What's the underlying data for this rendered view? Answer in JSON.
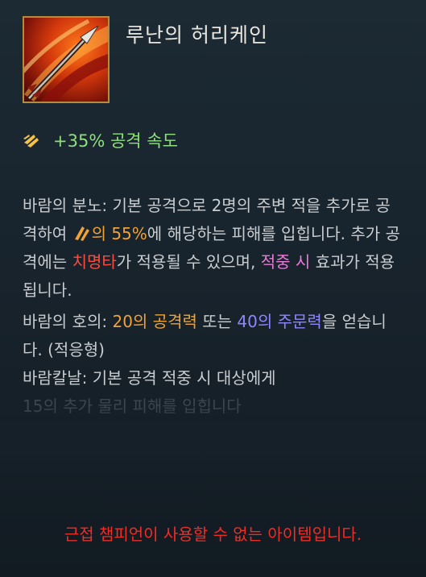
{
  "item": {
    "name": "루난의 허리케인",
    "icon": "hurricane-arrow-icon"
  },
  "stat": {
    "icon": "attack-speed-icon",
    "text": "+35% 공격 속도",
    "color": "#8fe07c"
  },
  "passive1": {
    "name": "바람의 분노:",
    "text1": " 기본 공격으로 2명의 주변 적을 추가로 공격하여 ",
    "ad_icon": "attack-damage-icon",
    "ratio": "의 55%",
    "text2": "에 해당하는 피해를 입힙니다. 추가 공격에는 ",
    "crit": "치명타",
    "text3": "가 적용될 수 있으며, ",
    "onhit": "적중 시",
    "text4": " 효과가 적용됩니다."
  },
  "passive2": {
    "name": "바람의 호의:",
    "text1": " ",
    "ad": "20의 공격력",
    "text2": " 또는 ",
    "ap": "40의 주문력",
    "text3": "을 얻습니다. (적응형)"
  },
  "passive3": {
    "name": "바람칼날:",
    "text1": " 기본 공격 적중 시 대상에게",
    "faded_text": "15의 추가 물리 피해를 입힙니다"
  },
  "warning": "근접 챔피언이 사용할 수 없는 아이템입니다.",
  "colors": {
    "highlight_orange": "#f0a236",
    "critical_red": "#ff4b3e",
    "onhit_pink": "#e67bd8",
    "ap_blue": "#8e86ff",
    "warning_red": "#ee2d24"
  }
}
